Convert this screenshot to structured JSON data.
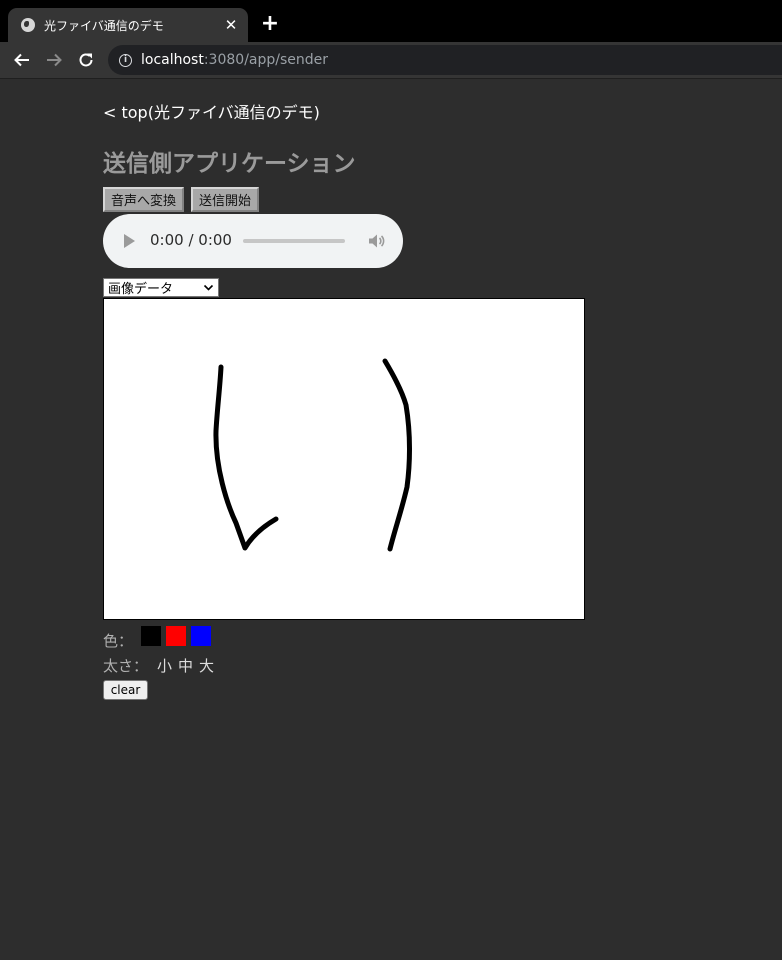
{
  "browser": {
    "tab_title": "光ファイバ通信のデモ",
    "url_host": "localhost",
    "url_rest": ":3080/app/sender",
    "icons": [
      "globe-icon",
      "close-icon",
      "plus-icon",
      "back-arrow-icon",
      "forward-arrow-icon",
      "reload-icon",
      "info-icon"
    ]
  },
  "page": {
    "back_link": "< top(光ファイバ通信のデモ)",
    "title": "送信側アプリケーション",
    "buttons": {
      "convert": "音声へ変換",
      "send": "送信開始"
    },
    "audio": {
      "time": "0:00 / 0:00",
      "progress": 0
    },
    "select_value": "画像データ",
    "color_label": "色：",
    "colors": [
      "#000000",
      "#ff0000",
      "#0000ff"
    ],
    "size_label": "太さ：",
    "sizes": [
      "小",
      "中",
      "大"
    ],
    "clear_label": "clear"
  }
}
